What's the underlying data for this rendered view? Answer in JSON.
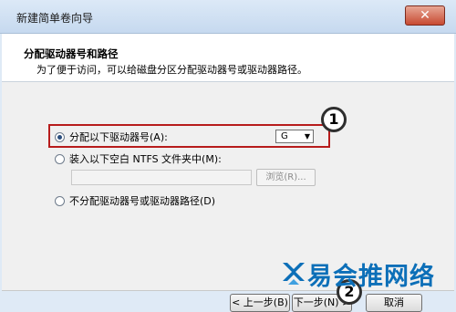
{
  "window": {
    "title": "新建简单卷向导",
    "close_label": "✕"
  },
  "header": {
    "title": "分配驱动器号和路径",
    "subtitle": "为了便于访问，可以给磁盘分区分配驱动器号或驱动器路径。"
  },
  "options": [
    {
      "label": "分配以下驱动器号(A):",
      "selected": true
    },
    {
      "label": "装入以下空白 NTFS 文件夹中(M):",
      "selected": false
    },
    {
      "label": "不分配驱动器号或驱动器路径(D)",
      "selected": false
    }
  ],
  "drive_letter": {
    "value": "G",
    "arrow": "▼"
  },
  "folder_path": {
    "value": ""
  },
  "browse_button": {
    "label": "浏览(R)..."
  },
  "annotations": {
    "badge1": "1",
    "badge2": "2"
  },
  "footer": {
    "back_label": "< 上一步(B)",
    "next_label": "下一步(N) >",
    "cancel_label": "取消"
  },
  "watermark": {
    "text": "易会推网络"
  },
  "colors": {
    "highlight": "#b71c1c",
    "watermark": "#0c6fb8"
  }
}
